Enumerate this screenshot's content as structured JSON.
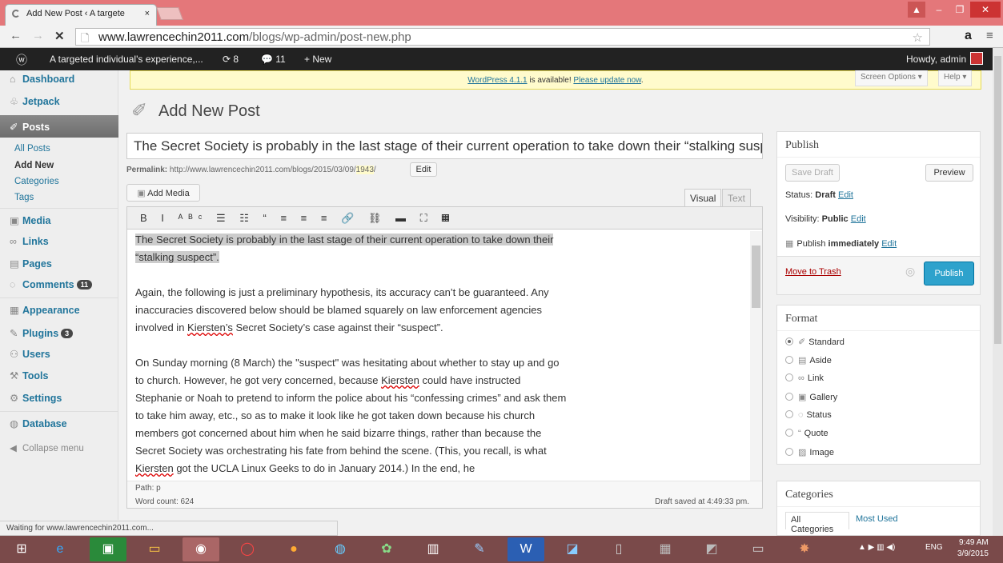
{
  "browser": {
    "tab_title": "Add New Post ‹ A targete",
    "tab_close": "×",
    "url_host": "www.lawrencechin2011.com",
    "url_path": "/blogs/wp-admin/post-new.php",
    "nav_back": "←",
    "nav_forward": "→",
    "stop": "✕",
    "status_text": "Waiting for www.lawrencechin2011.com..."
  },
  "adminbar": {
    "wp_logo": "ⓦ",
    "site_name": "A targeted individual's experience,...",
    "updates": "⟳ 8",
    "comments": "💬 11",
    "new": "+ New",
    "howdy": "Howdy, admin"
  },
  "sidebar": {
    "dashboard": "Dashboard",
    "jetpack": "Jetpack",
    "posts": "Posts",
    "posts_sub": [
      "All Posts",
      "Add New",
      "Categories",
      "Tags"
    ],
    "media": "Media",
    "links": "Links",
    "pages": "Pages",
    "comments": "Comments",
    "comments_count": "11",
    "appearance": "Appearance",
    "plugins": "Plugins",
    "plugins_count": "3",
    "users": "Users",
    "tools": "Tools",
    "settings": "Settings",
    "database": "Database",
    "collapse": "Collapse menu"
  },
  "notice": {
    "version_link": "WordPress 4.1.1",
    "text": " is available! ",
    "update_link": "Please update now",
    "end": "."
  },
  "screen_options": "Screen Options ▾",
  "help": "Help ▾",
  "page_title": "Add New Post",
  "post": {
    "title": "The Secret Society is probably in the last stage of their current operation to take down their “stalking suspect”.",
    "permalink_label": "Permalink:",
    "permalink_base": "http://www.lawrencechin2011.com/blogs/2015/03/09/",
    "permalink_slug": "1943",
    "permalink_end": "/",
    "edit_label": "Edit"
  },
  "editor": {
    "add_media": "Add Media",
    "tab_visual": "Visual",
    "tab_text": "Text",
    "toolbar": "B I ᴬᴮᶜ ☰ ☷ “ ≡ ≡ ≡ 🔗 ⛓ ▬ ⛶ ▦",
    "p1": "The Secret Society is probably in the last stage of their current operation to take down their “stalking suspect”.",
    "p2a": "Again, the following is just a preliminary hypothesis, its accuracy can’t be guaranteed. Any inaccuracies discovered below should be blamed squarely on law enforcement agencies involved in ",
    "p2_name": "Kiersten’s",
    "p2b": " Secret Society’s case against their “suspect”.",
    "p3a": "On Sunday morning (8 March) the \"suspect\" was hesitating about whether to stay up and go to church. However, he got very concerned, because ",
    "p3_name": "Kiersten",
    "p3b": " could have instructed Stephanie or Noah to pretend to inform the police about his “confessing crimes” and ask them to take him away, etc., so as to make it look like he got taken down because his church members got concerned about him when he said bizarre things, rather than because the Secret Society was orchestrating his fate from behind the scene. (This, you recall, is what ",
    "p3_name2": "Kiersten",
    "p3c": " got the UCLA Linux Geeks to do in January 2014.) In the end, he",
    "path": "Path: p",
    "word_count": "Word count: 624",
    "draft_saved": "Draft saved at 4:49:33 pm."
  },
  "publish": {
    "title": "Publish",
    "save_draft": "Save Draft",
    "preview": "Preview",
    "status_label": "Status: ",
    "status_value": "Draft",
    "visibility_label": "Visibility: ",
    "visibility_value": "Public",
    "publish_label": "Publish ",
    "publish_value": "immediately",
    "edit": "Edit",
    "trash": "Move to Trash",
    "publish_btn": "Publish"
  },
  "format": {
    "title": "Format",
    "options": [
      "Standard",
      "Aside",
      "Link",
      "Gallery",
      "Status",
      "Quote",
      "Image"
    ],
    "selected": "Standard"
  },
  "categories": {
    "title": "Categories",
    "tab_all": "All Categories",
    "tab_used": "Most Used"
  },
  "tray": {
    "lang": "ENG",
    "time": "9:49 AM",
    "date": "3/9/2015"
  },
  "colors": {
    "accent": "#21759b",
    "publish": "#2ea2cc",
    "trash": "#a00",
    "browser": "#e4777a"
  }
}
